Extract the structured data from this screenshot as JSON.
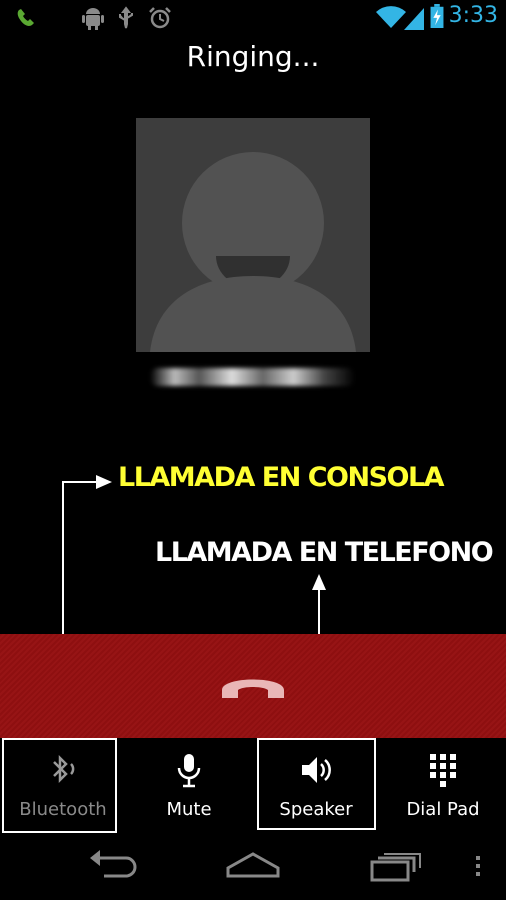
{
  "status_bar": {
    "time": "3:33",
    "icons": [
      "phone-call-icon",
      "android-debug-icon",
      "usb-icon",
      "alarm-icon",
      "wifi-icon",
      "signal-icon",
      "battery-charging-icon"
    ]
  },
  "call": {
    "state": "Ringing..."
  },
  "annotations": {
    "console": "LLAMADA EN CONSOLA",
    "phone": "LLAMADA EN TELEFONO",
    "console_color": "#ffff33",
    "phone_color": "#ffffff"
  },
  "colors": {
    "end_call_band": "#8e0f10",
    "end_call_icon": "#e9b7b7",
    "clock": "#33b5e5"
  },
  "controls": [
    {
      "label": "Bluetooth",
      "icon": "bluetooth-icon",
      "enabled": false
    },
    {
      "label": "Mute",
      "icon": "microphone-icon",
      "enabled": true
    },
    {
      "label": "Speaker",
      "icon": "speaker-icon",
      "enabled": true
    },
    {
      "label": "Dial Pad",
      "icon": "dialpad-icon",
      "enabled": true
    }
  ],
  "nav": [
    "back-icon",
    "home-icon",
    "recent-apps-icon",
    "overflow-menu-icon"
  ]
}
